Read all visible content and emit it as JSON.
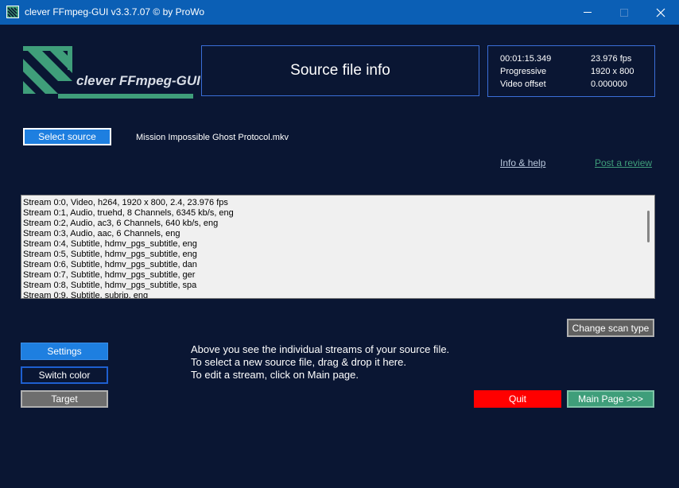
{
  "window": {
    "title": "clever FFmpeg-GUI v3.3.7.07    © by ProWo",
    "icon": "app-logo-icon",
    "controls": [
      "minimize-icon",
      "maximize-icon",
      "close-icon"
    ]
  },
  "logo": {
    "text": "clever FFmpeg-GUI",
    "color": "#3f9e7a"
  },
  "info_panel": {
    "title": "Source file info"
  },
  "stats": {
    "duration": "00:01:15.349",
    "fps": "23.976 fps",
    "scan_type": "Progressive",
    "resolution": "1920 x 800",
    "video_offset_label": "Video offset",
    "video_offset_value": "0.000000"
  },
  "source": {
    "select_label": "Select source",
    "filename": "Mission Impossible Ghost Protocol.mkv"
  },
  "links": {
    "info_help": "Info & help",
    "post_review": "Post a review"
  },
  "streams": [
    "Stream 0:0, Video, h264, 1920 x 800, 2.4, 23.976 fps",
    "Stream 0:1, Audio, truehd, 8 Channels, 6345 kb/s, eng",
    "Stream 0:2, Audio, ac3, 6 Channels, 640 kb/s, eng",
    "Stream 0:3, Audio, aac, 6 Channels, eng",
    "Stream 0:4, Subtitle, hdmv_pgs_subtitle, eng",
    "Stream 0:5, Subtitle, hdmv_pgs_subtitle, eng",
    "Stream 0:6, Subtitle, hdmv_pgs_subtitle, dan",
    "Stream 0:7, Subtitle, hdmv_pgs_subtitle, ger",
    "Stream 0:8, Subtitle, hdmv_pgs_subtitle, spa",
    "Stream 0:9, Subtitle, subrip, eng"
  ],
  "buttons": {
    "change_scan_type": "Change scan type",
    "settings": "Settings",
    "switch_color": "Switch color",
    "target": "Target",
    "quit": "Quit",
    "main_page": "Main Page >>>"
  },
  "help_text": [
    "Above you see the individual streams of your source file.",
    "To select a new source file, drag & drop it here.",
    "To edit a stream, click on Main page."
  ],
  "colors": {
    "background": "#0a1633",
    "titlebar": "#0b5fb5",
    "accent_blue": "#1e7fe0",
    "accent_green": "#3f9e7a",
    "quit_red": "#ff0000"
  }
}
